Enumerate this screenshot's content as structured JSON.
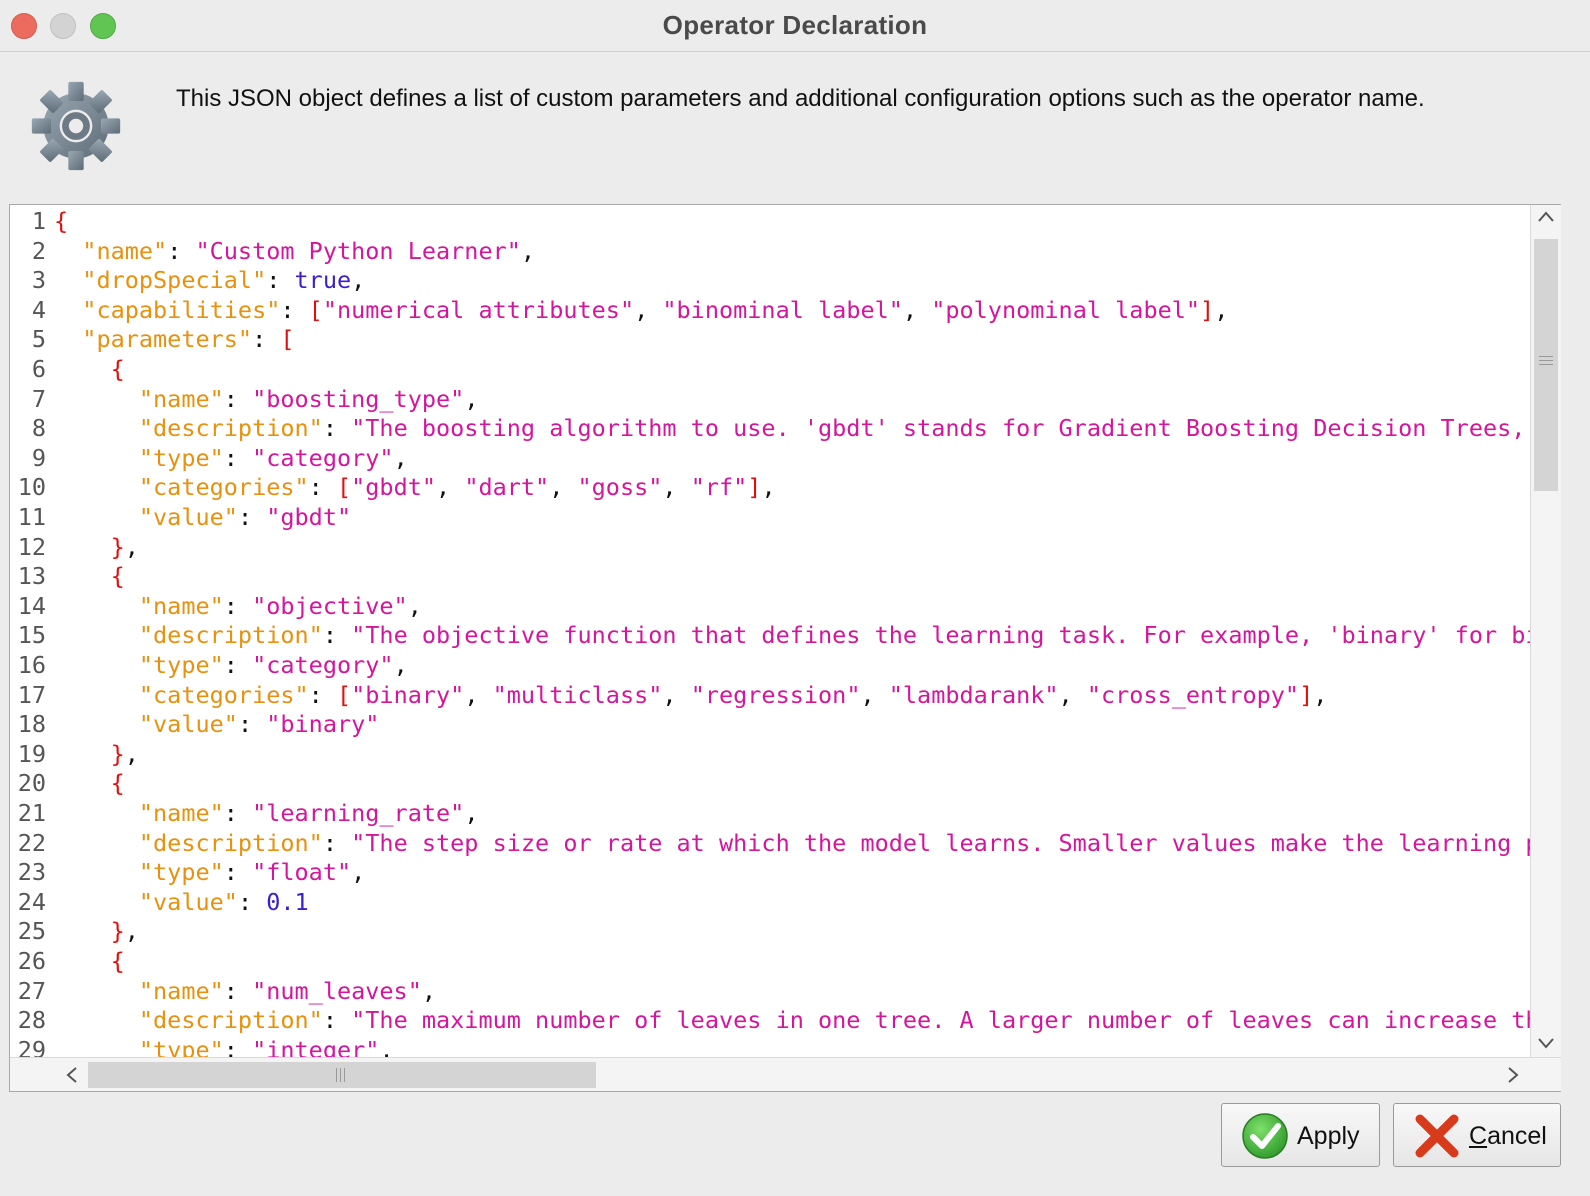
{
  "window": {
    "title": "Operator Declaration"
  },
  "header": {
    "icon": "gear-icon",
    "description": "This JSON object defines a list of custom parameters and additional configuration options such as the operator name."
  },
  "editor": {
    "lines": [
      {
        "n": "1",
        "tokens": [
          [
            "b",
            "{"
          ]
        ]
      },
      {
        "n": "2",
        "tokens": [
          [
            "p",
            "  "
          ],
          [
            "k",
            "\"name\""
          ],
          [
            "p",
            ": "
          ],
          [
            "s",
            "\"Custom Python Learner\""
          ],
          [
            "p",
            ","
          ]
        ]
      },
      {
        "n": "3",
        "tokens": [
          [
            "p",
            "  "
          ],
          [
            "k",
            "\"dropSpecial\""
          ],
          [
            "p",
            ": "
          ],
          [
            "n",
            "true"
          ],
          [
            "p",
            ","
          ]
        ]
      },
      {
        "n": "4",
        "tokens": [
          [
            "p",
            "  "
          ],
          [
            "k",
            "\"capabilities\""
          ],
          [
            "p",
            ": "
          ],
          [
            "b",
            "["
          ],
          [
            "s",
            "\"numerical attributes\""
          ],
          [
            "p",
            ", "
          ],
          [
            "s",
            "\"binominal label\""
          ],
          [
            "p",
            ", "
          ],
          [
            "s",
            "\"polynominal label\""
          ],
          [
            "b",
            "]"
          ],
          [
            "p",
            ","
          ]
        ]
      },
      {
        "n": "5",
        "tokens": [
          [
            "p",
            "  "
          ],
          [
            "k",
            "\"parameters\""
          ],
          [
            "p",
            ": "
          ],
          [
            "b",
            "["
          ]
        ]
      },
      {
        "n": "6",
        "tokens": [
          [
            "p",
            "    "
          ],
          [
            "b",
            "{"
          ]
        ]
      },
      {
        "n": "7",
        "tokens": [
          [
            "p",
            "      "
          ],
          [
            "k",
            "\"name\""
          ],
          [
            "p",
            ": "
          ],
          [
            "s",
            "\"boosting_type\""
          ],
          [
            "p",
            ","
          ]
        ]
      },
      {
        "n": "8",
        "tokens": [
          [
            "p",
            "      "
          ],
          [
            "k",
            "\"description\""
          ],
          [
            "p",
            ": "
          ],
          [
            "s",
            "\"The boosting algorithm to use. 'gbdt' stands for Gradient Boosting Decision Trees, 'd"
          ]
        ]
      },
      {
        "n": "9",
        "tokens": [
          [
            "p",
            "      "
          ],
          [
            "k",
            "\"type\""
          ],
          [
            "p",
            ": "
          ],
          [
            "s",
            "\"category\""
          ],
          [
            "p",
            ","
          ]
        ]
      },
      {
        "n": "10",
        "tokens": [
          [
            "p",
            "      "
          ],
          [
            "k",
            "\"categories\""
          ],
          [
            "p",
            ": "
          ],
          [
            "b",
            "["
          ],
          [
            "s",
            "\"gbdt\""
          ],
          [
            "p",
            ", "
          ],
          [
            "s",
            "\"dart\""
          ],
          [
            "p",
            ", "
          ],
          [
            "s",
            "\"goss\""
          ],
          [
            "p",
            ", "
          ],
          [
            "s",
            "\"rf\""
          ],
          [
            "b",
            "]"
          ],
          [
            "p",
            ","
          ]
        ]
      },
      {
        "n": "11",
        "tokens": [
          [
            "p",
            "      "
          ],
          [
            "k",
            "\"value\""
          ],
          [
            "p",
            ": "
          ],
          [
            "s",
            "\"gbdt\""
          ]
        ]
      },
      {
        "n": "12",
        "tokens": [
          [
            "p",
            "    "
          ],
          [
            "b",
            "}"
          ],
          [
            "p",
            ","
          ]
        ]
      },
      {
        "n": "13",
        "tokens": [
          [
            "p",
            "    "
          ],
          [
            "b",
            "{"
          ]
        ]
      },
      {
        "n": "14",
        "tokens": [
          [
            "p",
            "      "
          ],
          [
            "k",
            "\"name\""
          ],
          [
            "p",
            ": "
          ],
          [
            "s",
            "\"objective\""
          ],
          [
            "p",
            ","
          ]
        ]
      },
      {
        "n": "15",
        "tokens": [
          [
            "p",
            "      "
          ],
          [
            "k",
            "\"description\""
          ],
          [
            "p",
            ": "
          ],
          [
            "s",
            "\"The objective function that defines the learning task. For example, 'binary' for bina"
          ]
        ]
      },
      {
        "n": "16",
        "tokens": [
          [
            "p",
            "      "
          ],
          [
            "k",
            "\"type\""
          ],
          [
            "p",
            ": "
          ],
          [
            "s",
            "\"category\""
          ],
          [
            "p",
            ","
          ]
        ]
      },
      {
        "n": "17",
        "tokens": [
          [
            "p",
            "      "
          ],
          [
            "k",
            "\"categories\""
          ],
          [
            "p",
            ": "
          ],
          [
            "b",
            "["
          ],
          [
            "s",
            "\"binary\""
          ],
          [
            "p",
            ", "
          ],
          [
            "s",
            "\"multiclass\""
          ],
          [
            "p",
            ", "
          ],
          [
            "s",
            "\"regression\""
          ],
          [
            "p",
            ", "
          ],
          [
            "s",
            "\"lambdarank\""
          ],
          [
            "p",
            ", "
          ],
          [
            "s",
            "\"cross_entropy\""
          ],
          [
            "b",
            "]"
          ],
          [
            "p",
            ","
          ]
        ]
      },
      {
        "n": "18",
        "tokens": [
          [
            "p",
            "      "
          ],
          [
            "k",
            "\"value\""
          ],
          [
            "p",
            ": "
          ],
          [
            "s",
            "\"binary\""
          ]
        ]
      },
      {
        "n": "19",
        "tokens": [
          [
            "p",
            "    "
          ],
          [
            "b",
            "}"
          ],
          [
            "p",
            ","
          ]
        ]
      },
      {
        "n": "20",
        "tokens": [
          [
            "p",
            "    "
          ],
          [
            "b",
            "{"
          ]
        ]
      },
      {
        "n": "21",
        "tokens": [
          [
            "p",
            "      "
          ],
          [
            "k",
            "\"name\""
          ],
          [
            "p",
            ": "
          ],
          [
            "s",
            "\"learning_rate\""
          ],
          [
            "p",
            ","
          ]
        ]
      },
      {
        "n": "22",
        "tokens": [
          [
            "p",
            "      "
          ],
          [
            "k",
            "\"description\""
          ],
          [
            "p",
            ": "
          ],
          [
            "s",
            "\"The step size or rate at which the model learns. Smaller values make the learning pro"
          ]
        ]
      },
      {
        "n": "23",
        "tokens": [
          [
            "p",
            "      "
          ],
          [
            "k",
            "\"type\""
          ],
          [
            "p",
            ": "
          ],
          [
            "s",
            "\"float\""
          ],
          [
            "p",
            ","
          ]
        ]
      },
      {
        "n": "24",
        "tokens": [
          [
            "p",
            "      "
          ],
          [
            "k",
            "\"value\""
          ],
          [
            "p",
            ": "
          ],
          [
            "n",
            "0.1"
          ]
        ]
      },
      {
        "n": "25",
        "tokens": [
          [
            "p",
            "    "
          ],
          [
            "b",
            "}"
          ],
          [
            "p",
            ","
          ]
        ]
      },
      {
        "n": "26",
        "tokens": [
          [
            "p",
            "    "
          ],
          [
            "b",
            "{"
          ]
        ]
      },
      {
        "n": "27",
        "tokens": [
          [
            "p",
            "      "
          ],
          [
            "k",
            "\"name\""
          ],
          [
            "p",
            ": "
          ],
          [
            "s",
            "\"num_leaves\""
          ],
          [
            "p",
            ","
          ]
        ]
      },
      {
        "n": "28",
        "tokens": [
          [
            "p",
            "      "
          ],
          [
            "k",
            "\"description\""
          ],
          [
            "p",
            ": "
          ],
          [
            "s",
            "\"The maximum number of leaves in one tree. A larger number of leaves can increase the "
          ]
        ]
      },
      {
        "n": "29",
        "tokens": [
          [
            "p",
            "      "
          ],
          [
            "k",
            "\"type\""
          ],
          [
            "p",
            ": "
          ],
          [
            "s",
            "\"integer\""
          ],
          [
            "p",
            ","
          ]
        ]
      }
    ]
  },
  "buttons": {
    "apply": {
      "label": "Apply",
      "icon": "checkmark-icon"
    },
    "cancel": {
      "label_first": "C",
      "label_rest": "ancel",
      "icon": "x-icon"
    }
  },
  "colors": {
    "key": "#e8910f",
    "string": "#d4169c",
    "literal": "#3b1fcf",
    "bracket": "#e01010"
  }
}
